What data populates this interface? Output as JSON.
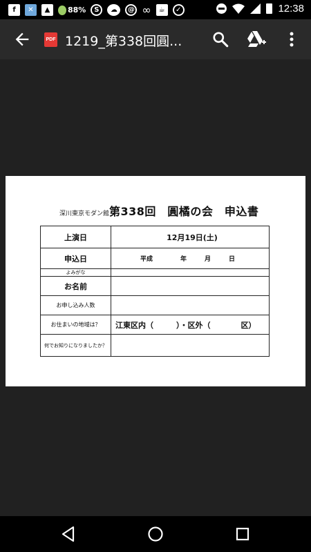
{
  "status_bar": {
    "battery_percent": "88%",
    "time": "12:38"
  },
  "app_bar": {
    "title": "1219_第338回圓...",
    "file_badge": "PDF",
    "icons": {
      "back": "arrow-back-icon",
      "search": "search-icon",
      "drive": "google-drive-add-icon",
      "more": "more-vert-icon"
    }
  },
  "document": {
    "venue": "深川東京モダン館",
    "title": "第338回　圓橘の会　申込書",
    "rows": [
      {
        "label": "上演日",
        "value": "12月19日(土)"
      },
      {
        "label": "申込日",
        "era": "平成",
        "year": "年",
        "month": "月",
        "day": "日"
      },
      {
        "label": "よみがな",
        "value": ""
      },
      {
        "label": "お名前",
        "value": ""
      },
      {
        "label": "お申し込み人数",
        "value": ""
      },
      {
        "label": "お住まいの地域は？",
        "value": "江東区内（　　　）・区外（　　　　区）"
      },
      {
        "label": "何でお知りになりましたか？",
        "value": ""
      }
    ]
  },
  "nav_bar": {
    "icons": {
      "back": "nav-back-icon",
      "home": "nav-home-icon",
      "recents": "nav-recents-icon"
    }
  }
}
